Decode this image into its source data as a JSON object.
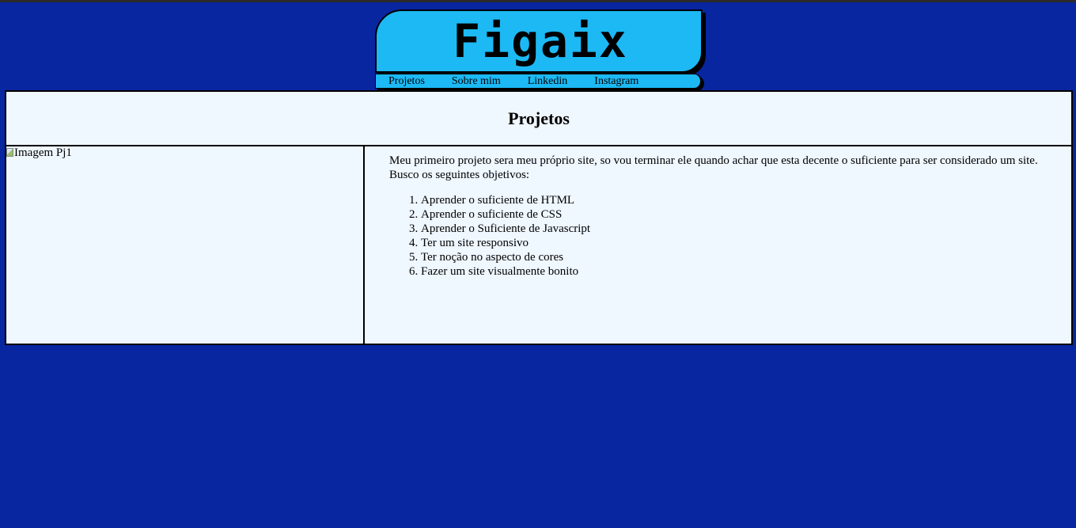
{
  "header": {
    "logo_text": "Figaix"
  },
  "nav": {
    "items": [
      {
        "label": "Projetos"
      },
      {
        "label": "Sobre mim"
      },
      {
        "label": "Linkedin"
      },
      {
        "label": "Instagram"
      }
    ]
  },
  "section": {
    "title": "Projetos",
    "project": {
      "image_alt": "Imagem Pj1",
      "description": "Meu primeiro projeto sera meu próprio site, so vou terminar ele quando achar que esta decente o suficiente para ser considerado um site. Busco os seguintes objetivos:",
      "goals": [
        "Aprender o suficiente de HTML",
        "Aprender o suficiente de CSS",
        "Aprender o Suficiente de Javascript",
        "Ter um site responsivo",
        "Ter noção no aspecto de cores",
        "Fazer um site visualmente bonito"
      ]
    }
  },
  "colors": {
    "background": "#0826a0",
    "accent": "#1cb9f4",
    "panel": "#eff7ff"
  }
}
